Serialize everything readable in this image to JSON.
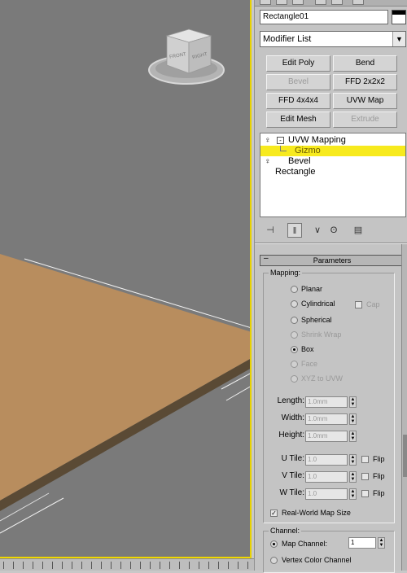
{
  "viewport": {
    "viewcube": {
      "front": "FRONT",
      "right": "RIGHT"
    },
    "colors": {
      "background": "#7a7a7a",
      "plane_top": "#b88d5e",
      "plane_edge": "#5a4a35",
      "border": "#f0d800"
    }
  },
  "panel": {
    "object_name": "Rectangle01",
    "modifier_list": "Modifier List",
    "buttons": [
      {
        "label": "Edit Poly",
        "enabled": true
      },
      {
        "label": "Bend",
        "enabled": true
      },
      {
        "label": "Bevel",
        "enabled": false
      },
      {
        "label": "FFD 2x2x2",
        "enabled": true
      },
      {
        "label": "FFD 4x4x4",
        "enabled": true
      },
      {
        "label": "UVW Map",
        "enabled": true
      },
      {
        "label": "Edit Mesh",
        "enabled": true
      },
      {
        "label": "Extrude",
        "enabled": false
      }
    ],
    "stack": [
      {
        "label": "UVW Mapping",
        "icon": "lightbulb-icon"
      },
      {
        "label": "Gizmo",
        "selected": true
      },
      {
        "label": "Bevel",
        "icon": "lightbulb-icon"
      },
      {
        "label": "Rectangle"
      }
    ],
    "stack_tools": [
      "pin-stack-icon",
      "show-end-result-icon",
      "make-unique-icon",
      "remove-modifier-icon",
      "configure-modifier-sets-icon"
    ],
    "rollout_title": "Parameters",
    "mapping": {
      "title": "Mapping:",
      "options": [
        {
          "label": "Planar",
          "enabled": true,
          "selected": false
        },
        {
          "label": "Cylindrical",
          "enabled": true,
          "selected": false
        },
        {
          "label": "Spherical",
          "enabled": true,
          "selected": false
        },
        {
          "label": "Shrink Wrap",
          "enabled": false,
          "selected": false
        },
        {
          "label": "Box",
          "enabled": true,
          "selected": true
        },
        {
          "label": "Face",
          "enabled": false,
          "selected": false
        },
        {
          "label": "XYZ to UVW",
          "enabled": false,
          "selected": false
        }
      ],
      "cap_label": "Cap",
      "length_label": "Length:",
      "length_value": "1.0mm",
      "width_label": "Width:",
      "width_value": "1.0mm",
      "height_label": "Height:",
      "height_value": "1.0mm",
      "utile_label": "U Tile:",
      "utile_value": "1.0",
      "vtile_label": "V Tile:",
      "vtile_value": "1.0",
      "wtile_label": "W Tile:",
      "wtile_value": "1.0",
      "flip_label": "Flip",
      "realworld_label": "Real-World Map Size",
      "realworld_checked": true
    },
    "channel": {
      "title": "Channel:",
      "map_channel_label": "Map Channel:",
      "map_channel_value": "1",
      "vertex_color_label": "Vertex Color Channel",
      "map_channel_selected": true
    }
  }
}
